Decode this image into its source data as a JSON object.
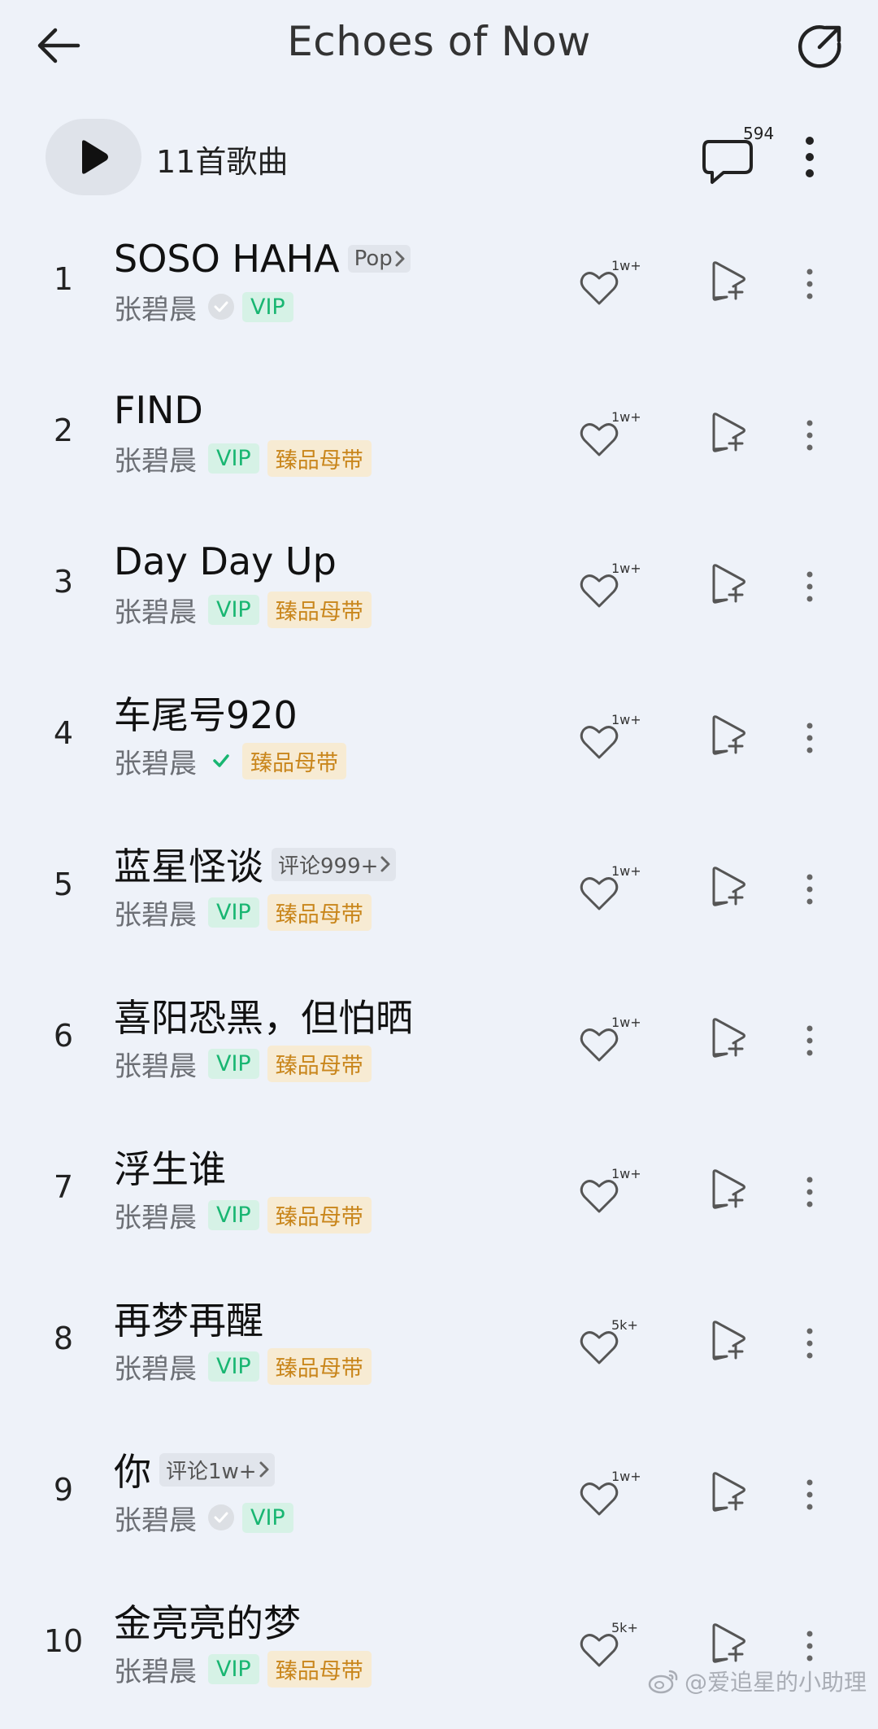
{
  "header": {
    "back_icon": "arrow-left-icon",
    "title": "Echoes of Now",
    "share_icon": "share-external-icon"
  },
  "toolbar": {
    "play_icon": "play-icon",
    "song_count": "11首歌曲",
    "comment_icon": "comment-bubble-icon",
    "comment_count": "594",
    "more_icon": "more-vertical-icon"
  },
  "colors": {
    "background": "#eef2f9",
    "vip_green": "#19b672",
    "hq_gold": "#c9861c",
    "verified_green": "#19b672"
  },
  "songs": [
    {
      "index": "1",
      "title": "SOSO HAHA",
      "tag": "Pop",
      "artist": "张碧晨",
      "verified": "grey",
      "vip": "VIP",
      "hq": "",
      "likes": "1w+"
    },
    {
      "index": "2",
      "title": "FIND",
      "tag": "",
      "artist": "张碧晨",
      "verified": "",
      "vip": "VIP",
      "hq": "臻品母带",
      "likes": "1w+"
    },
    {
      "index": "3",
      "title": "Day Day Up",
      "tag": "",
      "artist": "张碧晨",
      "verified": "",
      "vip": "VIP",
      "hq": "臻品母带",
      "likes": "1w+"
    },
    {
      "index": "4",
      "title": "车尾号920",
      "tag": "",
      "artist": "张碧晨",
      "verified": "green",
      "vip": "",
      "hq": "臻品母带",
      "likes": "1w+"
    },
    {
      "index": "5",
      "title": "蓝星怪谈",
      "tag": "评论999+",
      "artist": "张碧晨",
      "verified": "",
      "vip": "VIP",
      "hq": "臻品母带",
      "likes": "1w+"
    },
    {
      "index": "6",
      "title": "喜阳恐黑，但怕晒",
      "tag": "",
      "artist": "张碧晨",
      "verified": "",
      "vip": "VIP",
      "hq": "臻品母带",
      "likes": "1w+"
    },
    {
      "index": "7",
      "title": "浮生谁",
      "tag": "",
      "artist": "张碧晨",
      "verified": "",
      "vip": "VIP",
      "hq": "臻品母带",
      "likes": "1w+"
    },
    {
      "index": "8",
      "title": "再梦再醒",
      "tag": "",
      "artist": "张碧晨",
      "verified": "",
      "vip": "VIP",
      "hq": "臻品母带",
      "likes": "5k+"
    },
    {
      "index": "9",
      "title": "你",
      "tag": "评论1w+",
      "artist": "张碧晨",
      "verified": "grey",
      "vip": "VIP",
      "hq": "",
      "likes": "1w+"
    },
    {
      "index": "10",
      "title": "金亮亮的梦",
      "tag": "",
      "artist": "张碧晨",
      "verified": "",
      "vip": "VIP",
      "hq": "臻品母带",
      "likes": "5k+"
    }
  ],
  "row_icons": {
    "like": "heart-icon",
    "add": "add-to-playlist-icon",
    "more": "more-vertical-icon"
  },
  "watermark": {
    "icon": "weibo-logo-icon",
    "text": "@爱追星的小助理"
  }
}
